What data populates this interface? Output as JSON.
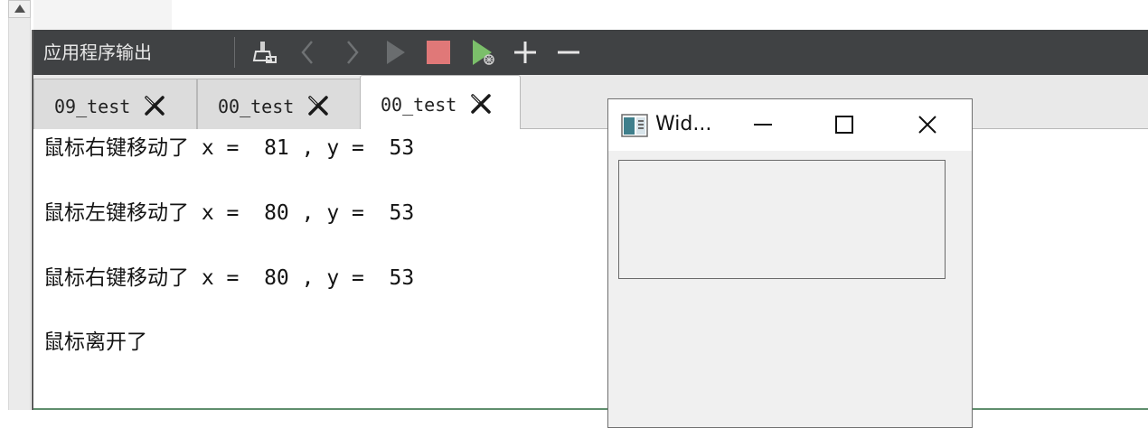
{
  "toolbar": {
    "title": "应用程序输出",
    "buttons": [
      {
        "name": "clean-output",
        "icon": "broom-icon"
      },
      {
        "name": "prev",
        "icon": "chevron-left-icon"
      },
      {
        "name": "next",
        "icon": "chevron-right-icon"
      },
      {
        "name": "run",
        "icon": "play-icon"
      },
      {
        "name": "stop",
        "icon": "stop-icon",
        "color": "#e07878"
      },
      {
        "name": "debug",
        "icon": "debug-run-icon",
        "color": "#7bbf6a"
      },
      {
        "name": "zoom-in",
        "icon": "plus-icon"
      },
      {
        "name": "zoom-out",
        "icon": "minus-icon"
      }
    ]
  },
  "tabs": [
    {
      "label": "09_test",
      "active": false
    },
    {
      "label": "00_test",
      "active": false
    },
    {
      "label": "00_test",
      "active": true
    }
  ],
  "output": {
    "lines": [
      "鼠标右键移动了 x =  81 , y =  53",
      "鼠标左键移动了 x =  80 , y =  53",
      "鼠标右键移动了 x =  80 , y =  53",
      "鼠标离开了"
    ]
  },
  "widget_window": {
    "title": "Wid...",
    "controls": [
      "minimize-icon",
      "maximize-icon",
      "close-icon"
    ]
  },
  "colors": {
    "toolbar_bg": "#404244",
    "stop_red": "#e07878",
    "debug_green": "#7bbf6a"
  }
}
